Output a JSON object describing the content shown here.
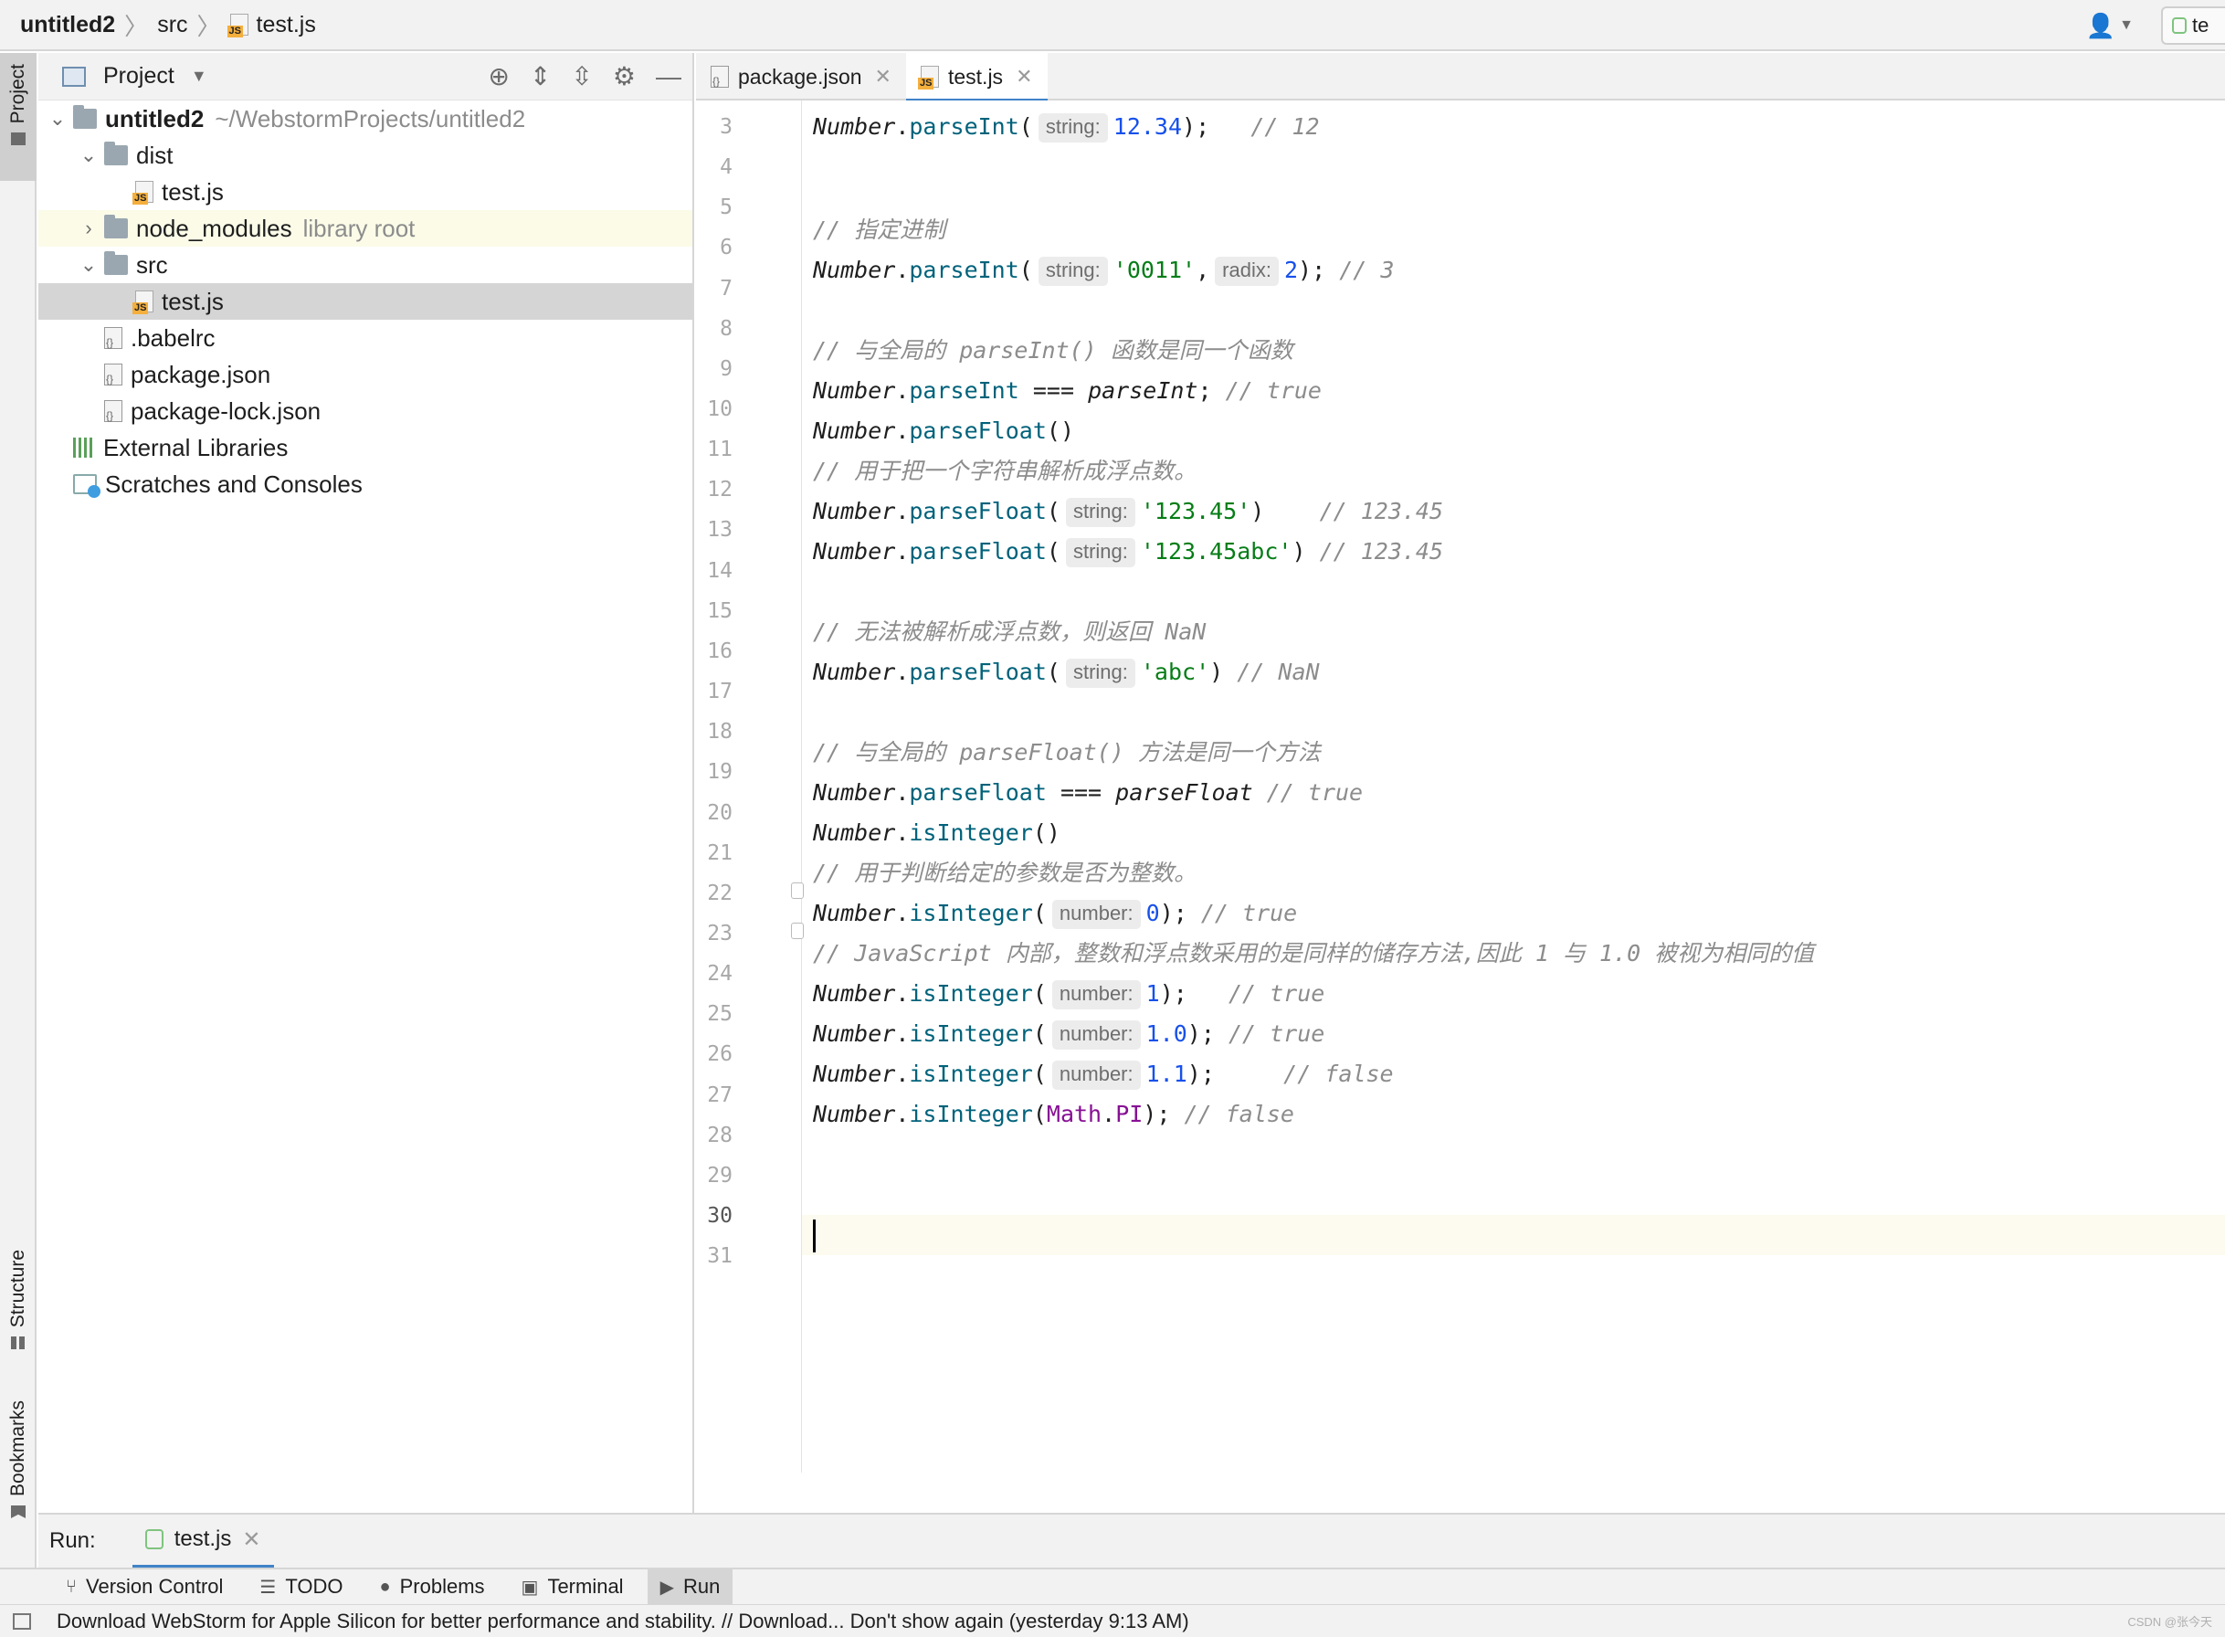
{
  "breadcrumb": {
    "project": "untitled2",
    "folder": "src",
    "file": "test.js"
  },
  "topbar": {
    "run_config_label": "te"
  },
  "left_strip": {
    "project": "Project",
    "structure": "Structure",
    "bookmarks": "Bookmarks"
  },
  "project_panel": {
    "title": "Project",
    "tree": [
      {
        "label": "untitled2",
        "extra": "~/WebstormProjects/untitled2",
        "icon": "folder-icon",
        "level": 0,
        "expanded": true
      },
      {
        "label": "dist",
        "extra": "",
        "icon": "folder-icon",
        "level": 1,
        "expanded": true
      },
      {
        "label": "test.js",
        "extra": "",
        "icon": "js-file-icon",
        "level": 2
      },
      {
        "label": "node_modules",
        "extra": "library root",
        "icon": "folder-icon",
        "level": 1,
        "expanded": false
      },
      {
        "label": "src",
        "extra": "",
        "icon": "folder-icon",
        "level": 1,
        "expanded": true
      },
      {
        "label": "test.js",
        "extra": "",
        "icon": "js-file-icon",
        "level": 2,
        "selected": true
      },
      {
        "label": ".babelrc",
        "extra": "",
        "icon": "config-file-icon",
        "level": 1
      },
      {
        "label": "package.json",
        "extra": "",
        "icon": "config-file-icon",
        "level": 1
      },
      {
        "label": "package-lock.json",
        "extra": "",
        "icon": "config-file-icon",
        "level": 1
      },
      {
        "label": "External Libraries",
        "extra": "",
        "icon": "libraries-icon",
        "level": 0
      },
      {
        "label": "Scratches and Consoles",
        "extra": "",
        "icon": "scratches-icon",
        "level": 0
      }
    ]
  },
  "editor_tabs": [
    {
      "label": "package.json",
      "icon": "config-file-icon",
      "active": false
    },
    {
      "label": "test.js",
      "icon": "js-file-icon",
      "active": true
    }
  ],
  "editor": {
    "line_numbers": [
      "3",
      "4",
      "5",
      "6",
      "7",
      "8",
      "9",
      "10",
      "11",
      "12",
      "13",
      "14",
      "15",
      "16",
      "17",
      "18",
      "19",
      "20",
      "21",
      "22",
      "23",
      "24",
      "25",
      "26",
      "27",
      "28",
      "29",
      "30",
      "31"
    ],
    "current_line": "30",
    "lines": {
      "l3": {
        "obj": "Number",
        "fn": "parseInt",
        "hint": "string:",
        "num": "12.34",
        "end": ");",
        "cmt": "// 12"
      },
      "l5": {
        "cmt": "// 指定进制"
      },
      "l6": {
        "obj": "Number",
        "fn": "parseInt",
        "hint1": "string:",
        "str": "'0011'",
        "hint2": "radix:",
        "num": "2",
        "end": ");",
        "cmt": "// 3"
      },
      "l8": {
        "cmt": "// 与全局的 parseInt() 函数是同一个函数"
      },
      "l9": {
        "obj": "Number",
        "fn": "parseInt",
        "op": "===",
        "global": "parseInt",
        "cmt": "// true"
      },
      "l10": {
        "obj": "Number",
        "fn": "parseFloat",
        "end": "()"
      },
      "l11": {
        "cmt": "// 用于把一个字符串解析成浮点数。"
      },
      "l12": {
        "obj": "Number",
        "fn": "parseFloat",
        "hint": "string:",
        "str": "'123.45'",
        "end": ")",
        "cmt": "// 123.45"
      },
      "l13": {
        "obj": "Number",
        "fn": "parseFloat",
        "hint": "string:",
        "str": "'123.45abc'",
        "end": ")",
        "cmt": "// 123.45"
      },
      "l15": {
        "cmt": "// 无法被解析成浮点数，则返回 NaN"
      },
      "l16": {
        "obj": "Number",
        "fn": "parseFloat",
        "hint": "string:",
        "str": "'abc'",
        "end": ")",
        "cmt": "// NaN"
      },
      "l18": {
        "cmt": "// 与全局的 parseFloat() 方法是同一个方法"
      },
      "l19": {
        "obj": "Number",
        "fn": "parseFloat",
        "op": "===",
        "global": "parseFloat",
        "cmt": "// true"
      },
      "l20": {
        "obj": "Number",
        "fn": "isInteger",
        "end": "()"
      },
      "l21": {
        "cmt": "// 用于判断给定的参数是否为整数。"
      },
      "l22": {
        "obj": "Number",
        "fn": "isInteger",
        "hint": "number:",
        "num": "0",
        "end": ");",
        "cmt": "// true"
      },
      "l23": {
        "cmt": "// JavaScript 内部，整数和浮点数采用的是同样的储存方法,因此 1 与 1.0 被视为相同的值"
      },
      "l24": {
        "obj": "Number",
        "fn": "isInteger",
        "hint": "number:",
        "num": "1",
        "end": ");",
        "cmt": "// true"
      },
      "l25": {
        "obj": "Number",
        "fn": "isInteger",
        "hint": "number:",
        "num": "1.0",
        "end": ");",
        "cmt": "// true"
      },
      "l26": {
        "obj": "Number",
        "fn": "isInteger",
        "hint": "number:",
        "num": "1.1",
        "end": ");",
        "cmt": "// false"
      },
      "l27": {
        "obj": "Number",
        "fn": "isInteger",
        "arg_obj": "Math",
        "arg_prop": "PI",
        "end": ");",
        "cmt": "// false"
      }
    }
  },
  "run_panel": {
    "label": "Run:",
    "tab": "test.js"
  },
  "bottom_tools": [
    {
      "label": "Version Control",
      "icon": "branch-icon",
      "active": false
    },
    {
      "label": "TODO",
      "icon": "list-icon",
      "active": false
    },
    {
      "label": "Problems",
      "icon": "warning-icon",
      "active": false
    },
    {
      "label": "Terminal",
      "icon": "terminal-icon",
      "active": false
    },
    {
      "label": "Run",
      "icon": "play-icon",
      "active": true
    }
  ],
  "status": {
    "message": "Download WebStorm for Apple Silicon for better performance and stability. // Download...   Don't show again (yesterday 9:13 AM)",
    "watermark": "CSDN @张今天"
  },
  "colors": {
    "accent": "#4083c9",
    "current_line": "#fdfbef",
    "library_row": "#fbfbe8",
    "selected_row": "#d5d5d5"
  }
}
